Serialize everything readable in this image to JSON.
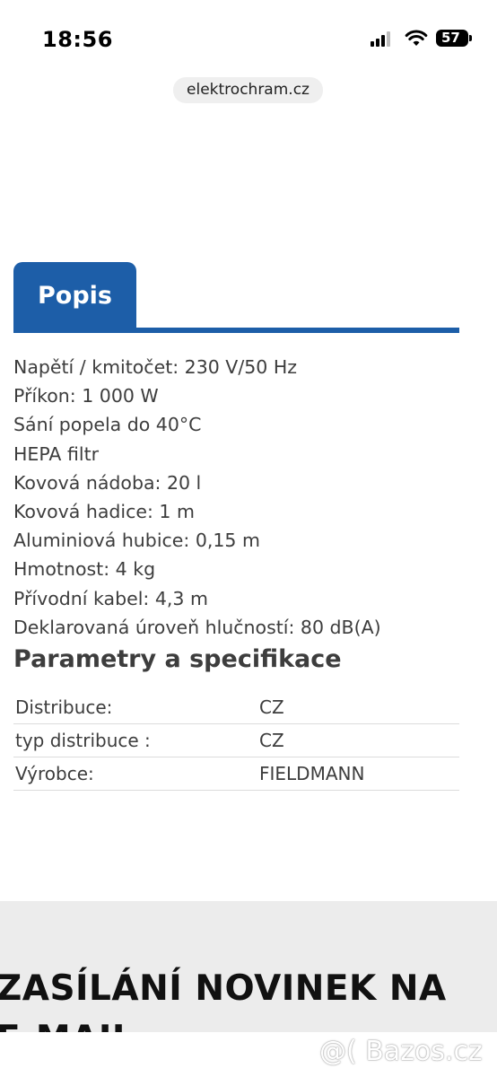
{
  "status_bar": {
    "time": "18:56",
    "battery": "57"
  },
  "browser": {
    "url": "elektrochram.cz"
  },
  "tabs": {
    "active_label": "Popis"
  },
  "description": {
    "lines": [
      "Napětí / kmitočet: 230 V/50 Hz",
      "Příkon: 1 000 W",
      "Sání popela do 40°C",
      "HEPA filtr",
      "Kovová nádoba: 20 l",
      "Kovová hadice: 1 m",
      "Aluminiová hubice: 0,15 m",
      "Hmotnost: 4 kg",
      "Přívodní kabel: 4,3 m",
      "Deklarovaná úroveň hlučností: 80 dB(A)"
    ]
  },
  "specs": {
    "heading": "Parametry a specifikace",
    "rows": [
      {
        "label": "Distribuce:",
        "value": "CZ"
      },
      {
        "label": "typ distribuce :",
        "value": "CZ"
      },
      {
        "label": "Výrobce:",
        "value": "FIELDMANN"
      }
    ]
  },
  "newsletter": {
    "title": "ZASÍLÁNÍ NOVINEK NA E-MAIL"
  },
  "watermark": {
    "text": "@( Bazos.cz"
  },
  "colors": {
    "accent": "#1d5ea8",
    "text": "#3d3d3d",
    "newsletter_bg": "#ececec"
  }
}
